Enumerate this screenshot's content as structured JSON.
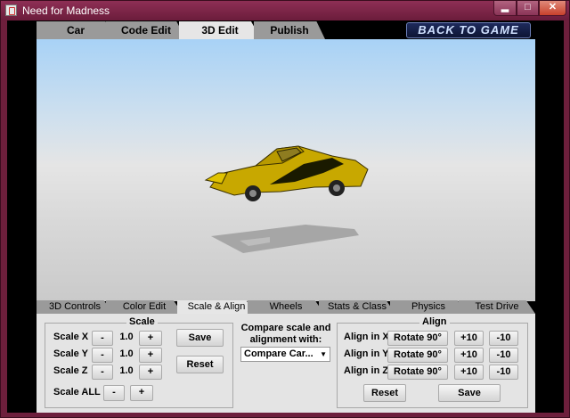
{
  "window": {
    "title": "Need for Madness",
    "min_glyph": "▂",
    "max_glyph": "□",
    "close_glyph": "✕"
  },
  "top_tabs": [
    "Car",
    "Code Edit",
    "3D Edit",
    "Publish"
  ],
  "back_button": "BACK TO GAME",
  "sub_tabs": [
    "3D Controls",
    "Color Edit",
    "Scale & Align",
    "Wheels",
    "Stats & Class",
    "Physics",
    "Test Drive"
  ],
  "scale": {
    "legend": "Scale",
    "rows": [
      {
        "label": "Scale X",
        "minus": "-",
        "value": "1.0",
        "plus": "+"
      },
      {
        "label": "Scale Y",
        "minus": "-",
        "value": "1.0",
        "plus": "+"
      },
      {
        "label": "Scale Z",
        "minus": "-",
        "value": "1.0",
        "plus": "+"
      }
    ],
    "all": {
      "label": "Scale ALL",
      "minus": "-",
      "plus": "+"
    },
    "save": "Save",
    "reset": "Reset"
  },
  "compare": {
    "label": "Compare scale and alignment with:",
    "selected": "Compare Car..."
  },
  "align": {
    "legend": "Align",
    "rows": [
      {
        "label": "Align in X",
        "rotate": "Rotate 90°",
        "plus": "+10",
        "minus": "-10"
      },
      {
        "label": "Align in Y",
        "rotate": "Rotate 90°",
        "plus": "+10",
        "minus": "-10"
      },
      {
        "label": "Align in Z",
        "rotate": "Rotate 90°",
        "plus": "+10",
        "minus": "-10"
      }
    ],
    "reset": "Reset",
    "save": "Save"
  },
  "colors": {
    "titlebar": "#7a2446",
    "car_body": "#c8a800",
    "car_stripe": "#1a1a00",
    "shadow": "#a6a6a6"
  }
}
